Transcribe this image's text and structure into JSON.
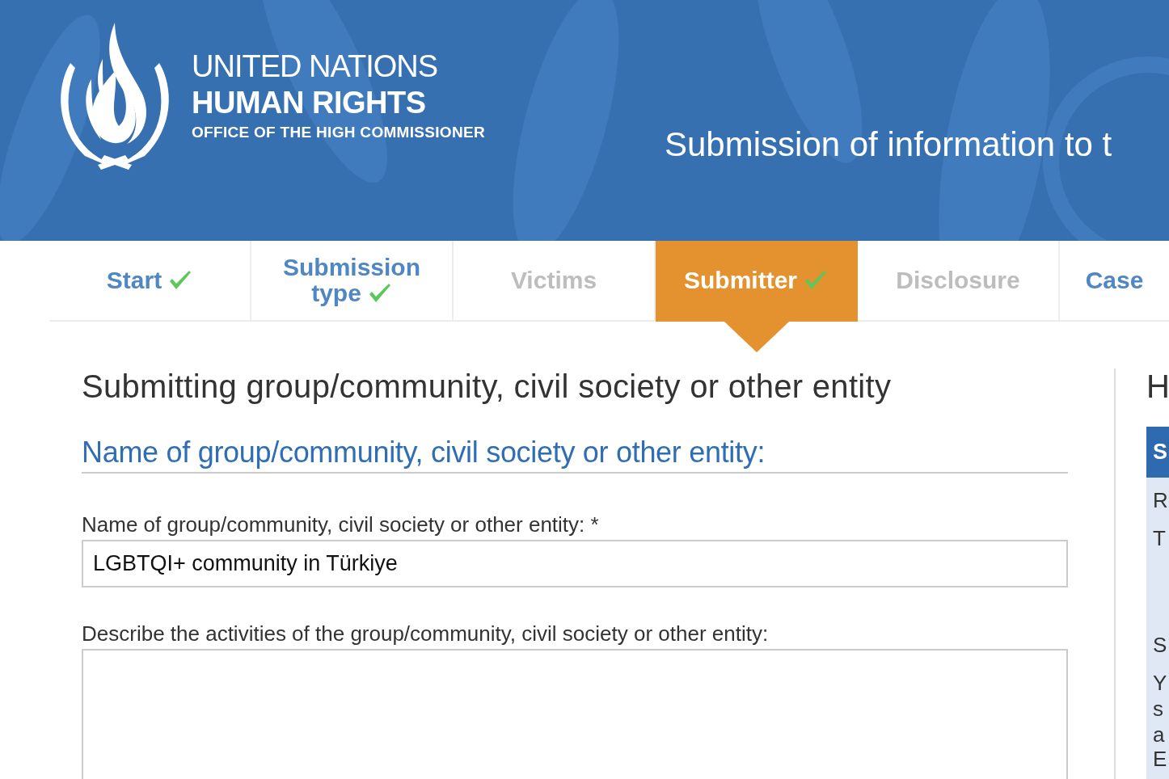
{
  "header": {
    "org_line_1": "UNITED NATIONS",
    "org_line_2": "HUMAN RIGHTS",
    "org_line_3": "OFFICE OF THE HIGH COMMISSIONER",
    "title": "Submission of information to t"
  },
  "tabs": [
    {
      "label": "Start",
      "selected": false,
      "completed": true,
      "disabled": false
    },
    {
      "label": "Submission type",
      "selected": false,
      "completed": true,
      "disabled": false
    },
    {
      "label": "Victims",
      "selected": false,
      "completed": false,
      "disabled": true
    },
    {
      "label": "Submitter",
      "selected": true,
      "completed": true,
      "disabled": false
    },
    {
      "label": "Disclosure",
      "selected": false,
      "completed": false,
      "disabled": true
    },
    {
      "label": "Case",
      "selected": false,
      "completed": false,
      "disabled": false
    }
  ],
  "form": {
    "heading": "Submitting group/community, civil society or other entity",
    "section_title": "Name of group/community, civil society or other entity:",
    "fields": [
      {
        "kind": "text",
        "label": "Name of group/community, civil society or other entity: *",
        "value": "LGBTQI+ community in Türkiye"
      },
      {
        "kind": "textarea",
        "label": "Describe the activities of the group/community, civil society or other entity:"
      }
    ]
  },
  "sidebar": {
    "heading": "H",
    "box_title": "S",
    "lines": [
      "R",
      "T",
      "S",
      "Y",
      "s",
      "a",
      "E"
    ]
  }
}
